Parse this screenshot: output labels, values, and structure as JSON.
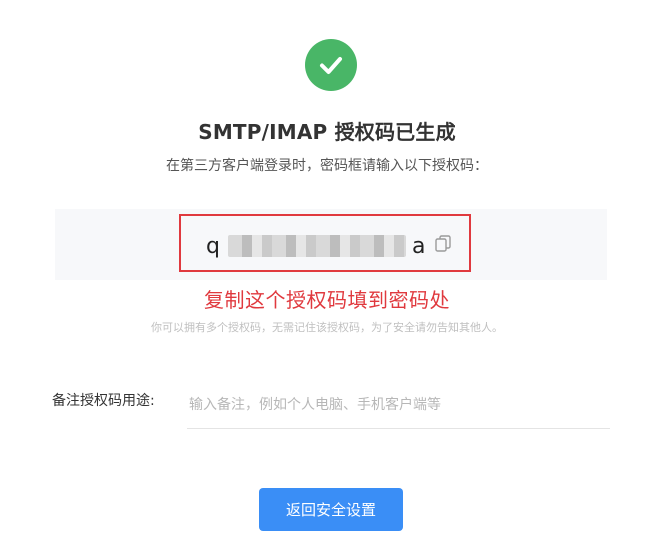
{
  "status": {
    "icon": "check-icon",
    "color": "#49b667"
  },
  "header": {
    "title": "SMTP/IMAP 授权码已生成",
    "subtitle": "在第三方客户端登录时，密码框请输入以下授权码："
  },
  "auth_code": {
    "first_char": "q",
    "last_char": "a",
    "masked": true,
    "copy_icon": "copy-icon"
  },
  "annotation": {
    "text": "复制这个授权码填到密码处",
    "color": "#e0393e"
  },
  "hint": {
    "text": "你可以拥有多个授权码，无需记住该授权码，为了安全请勿告知其他人。"
  },
  "note": {
    "label": "备注授权码用途:",
    "value": "",
    "placeholder": "输入备注，例如个人电脑、手机客户端等"
  },
  "actions": {
    "back_label": "返回安全设置",
    "accent": "#3a8ef6"
  }
}
